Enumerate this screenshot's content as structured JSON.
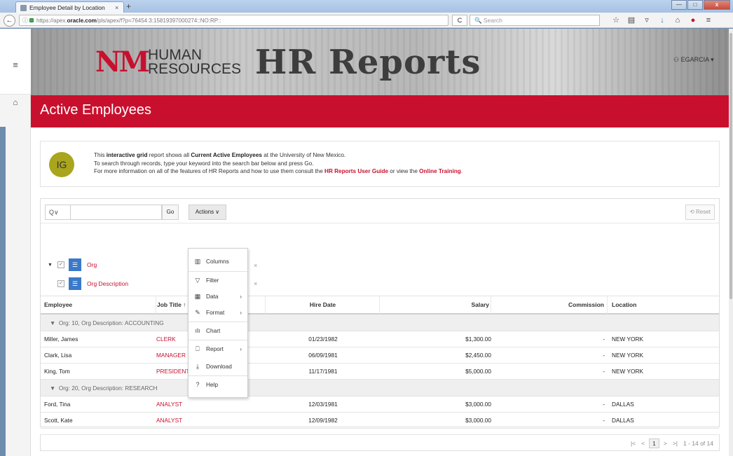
{
  "browser": {
    "tab_title": "Employee Detail by Location",
    "url_prefix": "https://apex.",
    "url_domain": "oracle.com",
    "url_rest": "/pls/apex/f?p=76454:3:15819397000274::NO:RP::",
    "search_placeholder": "Search"
  },
  "header": {
    "logo_mark": "NM",
    "logo_line1": "HUMAN",
    "logo_line2": "RESOURCES",
    "title": "HR Reports",
    "user": "EGARCIA ▾"
  },
  "page": {
    "title": "Active Employees"
  },
  "info": {
    "badge": "IG",
    "line1_a": "This ",
    "line1_b": "interactive grid",
    "line1_c": " report shows all ",
    "line1_d": "Current Active Employees",
    "line1_e": " at the University of New Mexico.",
    "line2": "To search through records, type your keyword into the search bar below and press Go.",
    "line3_a": "For more information on all of the features of HR Reports and how to use them consult the ",
    "line3_link1": "HR Reports User Guide",
    "line3_b": " or view the ",
    "line3_link2": "Online Training",
    "line3_c": "."
  },
  "toolbar": {
    "search_menu": "Q∨",
    "go": "Go",
    "actions": "Actions ∨",
    "reset": "Reset"
  },
  "controls": [
    {
      "label": "Org"
    },
    {
      "label": "Org Description"
    }
  ],
  "columns": {
    "employee": "Employee",
    "job_title": "Job Title ↑",
    "hire_date": "Hire Date",
    "salary": "Salary",
    "commission": "Commission",
    "location": "Location"
  },
  "groups": [
    {
      "label": "Org: 10, Org Description: ACCOUNTING"
    },
    {
      "label": "Org: 20, Org Description: RESEARCH"
    }
  ],
  "rows": [
    {
      "employee": "Miller, James",
      "job": "CLERK",
      "hire": "01/23/1982",
      "salary": "$1,300.00",
      "commission": "-",
      "location": "NEW YORK"
    },
    {
      "employee": "Clark, Lisa",
      "job": "MANAGER",
      "hire": "06/09/1981",
      "salary": "$2,450.00",
      "commission": "-",
      "location": "NEW YORK"
    },
    {
      "employee": "King, Tom",
      "job": "PRESIDENT",
      "hire": "11/17/1981",
      "salary": "$5,000.00",
      "commission": "-",
      "location": "NEW YORK"
    },
    {
      "employee": "Ford, Tina",
      "job": "ANALYST",
      "hire": "12/03/1981",
      "salary": "$3,000.00",
      "commission": "-",
      "location": "DALLAS"
    },
    {
      "employee": "Scott, Kate",
      "job": "ANALYST",
      "hire": "12/09/1982",
      "salary": "$3,000.00",
      "commission": "-",
      "location": "DALLAS"
    }
  ],
  "menu": {
    "columns": "Columns",
    "filter": "Filter",
    "data": "Data",
    "format": "Format",
    "chart": "Chart",
    "report": "Report",
    "download": "Download",
    "help": "Help"
  },
  "pager": {
    "current": "1",
    "range": "1 - 14 of 14"
  },
  "colors": {
    "brand_red": "#c8102e",
    "badge_olive": "#a9a51d",
    "control_blue": "#3a79c9"
  }
}
